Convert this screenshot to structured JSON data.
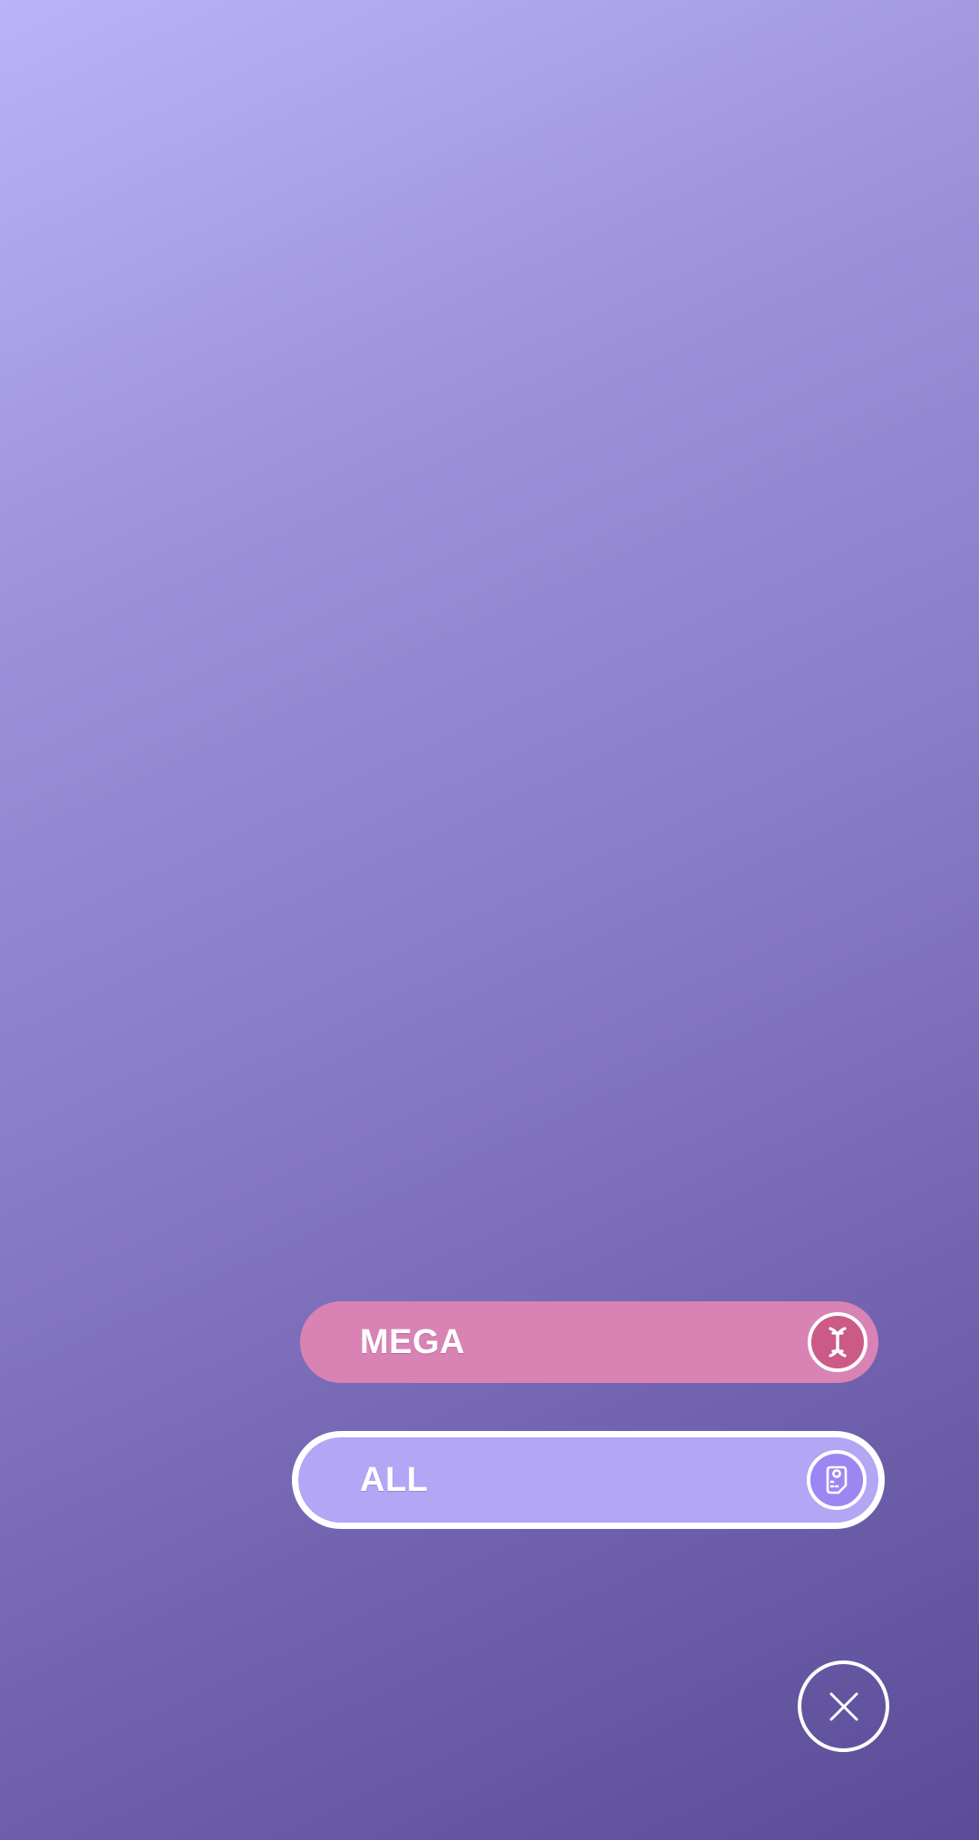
{
  "colors": {
    "background_top": "#bab3f7",
    "background_bottom": "#5b4c98",
    "mega_pill": "#d983b5",
    "mega_icon": "#cb5b86",
    "all_pill": "#b2a6f5",
    "all_icon": "#9c87f2",
    "outline": "#ffffff"
  },
  "filters": [
    {
      "label": "MEGA",
      "icon": "dna-helix-icon",
      "selected": false
    },
    {
      "label": "ALL",
      "icon": "pokedex-icon",
      "selected": true
    }
  ],
  "close": {
    "icon": "close-icon"
  }
}
